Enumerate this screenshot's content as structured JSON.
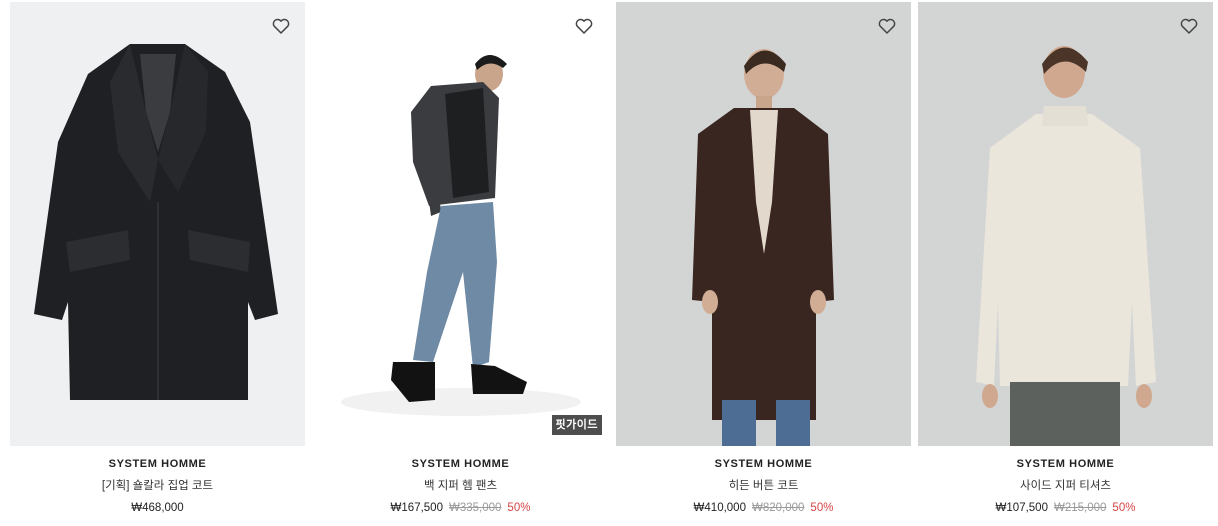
{
  "products": [
    {
      "brand": "SYSTEM HOMME",
      "name": "[기획] 숄칼라 집업 코트",
      "price": "₩468,000",
      "original_price": "",
      "discount": "",
      "badge": "",
      "wishlist_icon": "heart-outline-icon"
    },
    {
      "brand": "SYSTEM HOMME",
      "name": "백 지퍼 헴 팬츠",
      "price": "₩167,500",
      "original_price": "₩335,000",
      "discount": "50%",
      "badge": "핏가이드",
      "wishlist_icon": "heart-outline-icon"
    },
    {
      "brand": "SYSTEM HOMME",
      "name": "히든 버튼 코트",
      "price": "₩410,000",
      "original_price": "₩820,000",
      "discount": "50%",
      "badge": "",
      "wishlist_icon": "heart-outline-icon"
    },
    {
      "brand": "SYSTEM HOMME",
      "name": "사이드 지퍼 티셔츠",
      "price": "₩107,500",
      "original_price": "₩215,000",
      "discount": "50%",
      "badge": "",
      "wishlist_icon": "heart-outline-icon"
    }
  ],
  "colors": {
    "discount": "#d64545",
    "original_price": "#9a9a9a",
    "image_bg_light": "#eef0f2",
    "image_bg_studio": "#d3d5d4"
  }
}
